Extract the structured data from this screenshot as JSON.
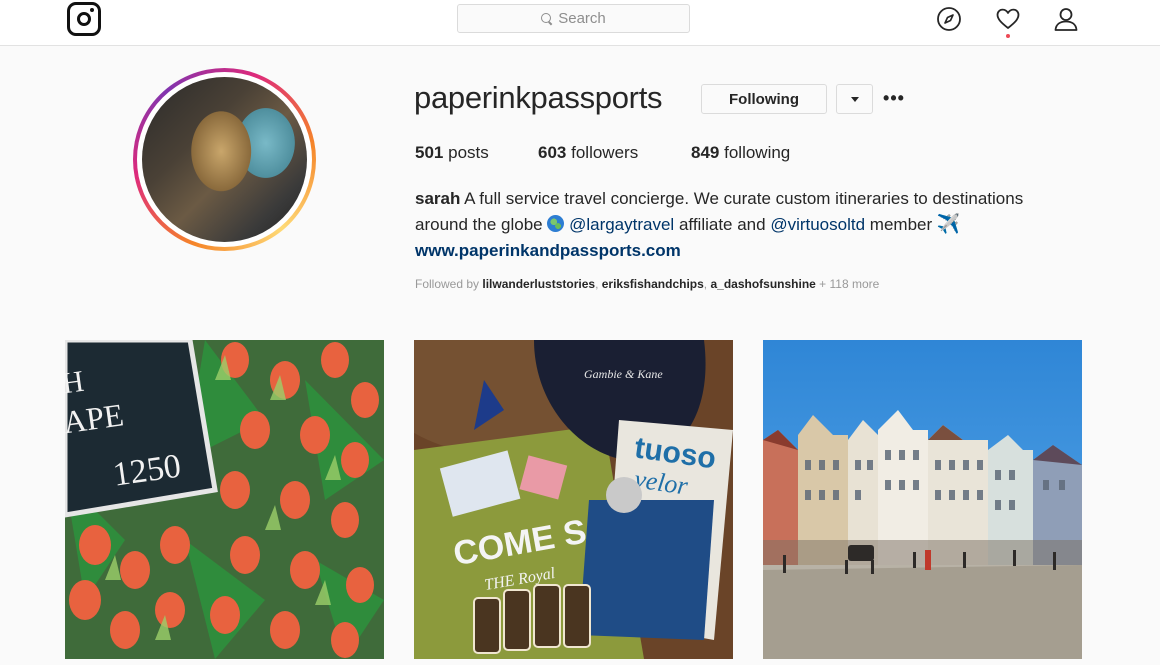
{
  "nav": {
    "search_placeholder": "Search",
    "icons": [
      "instagram-logo-icon",
      "search-icon",
      "compass-icon",
      "heart-icon",
      "user-icon"
    ]
  },
  "profile": {
    "username": "paperinkpassports",
    "following_button": "Following",
    "more_glyph": "•••",
    "stats": {
      "posts_count": "501",
      "posts_label": "posts",
      "followers_count": "603",
      "followers_label": "followers",
      "following_count": "849",
      "following_label": "following"
    },
    "bio": {
      "name": "sarah",
      "text1": " A full service travel concierge. We curate custom itineraries to destinations around the globe ",
      "mention1": "@largaytravel",
      "text2": " affiliate and ",
      "mention2": "@virtuosoltd",
      "text3": " member ",
      "plane_emoji": "✈️",
      "website": "www.paperinkandpassports.com"
    },
    "followed_by": {
      "prefix": "Followed by ",
      "user1": "lilwanderluststories",
      "sep": ", ",
      "user2": "eriksfishandchips",
      "user3": "a_dashofsunshine",
      "more": " + 118 more"
    }
  },
  "posts": [
    {
      "image_text": "H APE 1250"
    },
    {
      "image_text": "COME S THE Royal"
    },
    {
      "image_text": ""
    }
  ],
  "colors": {
    "link": "#003569",
    "ring_start": "#f58529",
    "ring_mid": "#dd2a7b",
    "notification_dot": "#ed4956"
  }
}
